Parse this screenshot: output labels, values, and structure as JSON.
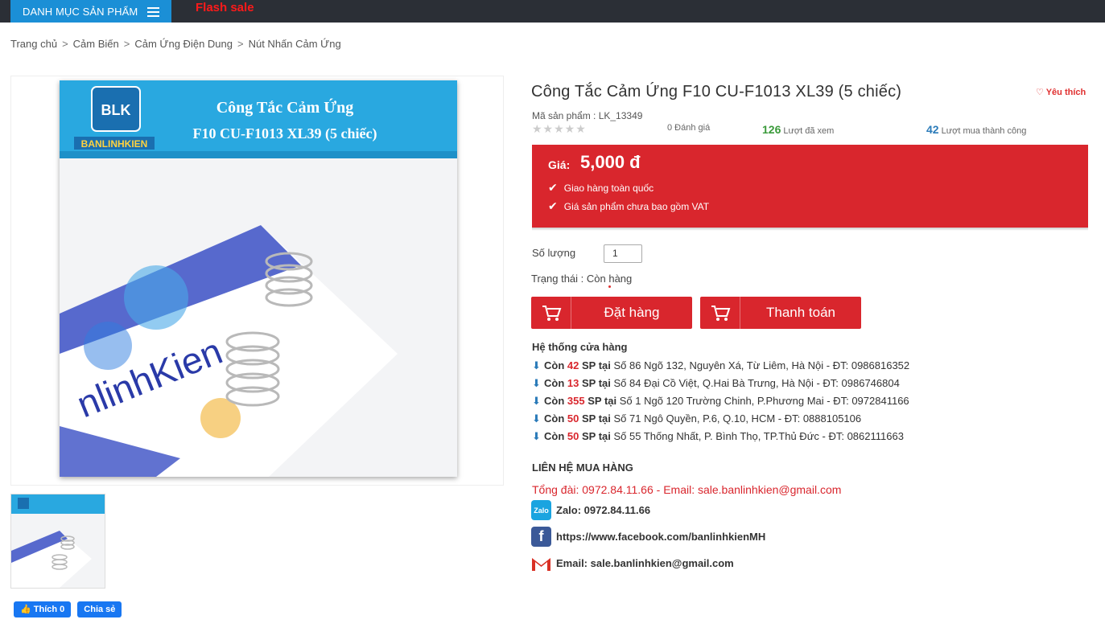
{
  "topbar": {
    "menu_label": "DANH MỤC SẢN PHẨM",
    "flash_label": "Flash sale"
  },
  "breadcrumb": [
    "Trang chủ",
    "Cảm Biến",
    "Cảm Ứng Điện Dung",
    "Nút Nhấn Cảm Ứng"
  ],
  "product": {
    "title": "Công Tắc Cảm Ứng F10 CU-F1013 XL39 (5 chiếc)",
    "image_title_line1": "Công Tắc Cảm Ứng",
    "image_title_line2": "F10 CU-F1013 XL39 (5 chiếc)",
    "logo_text": "BANLINHKIEN",
    "logo_mark": "BLK",
    "favorite_label": "Yêu thích",
    "sku_label": "Mã sản phẩm : LK_13349",
    "rating_label": "0 Đánh giá",
    "views_count": "126",
    "views_label": "Lượt đã xem",
    "purchases_count": "42",
    "purchases_label": "Lượt mua thành công",
    "price_label": "Giá:",
    "price_value": "5,000 đ",
    "features": [
      "Giao hàng toàn quốc",
      "Giá sản phẩm chưa bao gồm VAT"
    ],
    "quantity_label": "Số lượng",
    "quantity_value": "1",
    "status_label": "Trạng thái : Còn hàng",
    "order_button": "Đặt hàng",
    "checkout_button": "Thanh toán"
  },
  "stores": {
    "heading": "Hệ thống cửa hàng",
    "items": [
      {
        "pre": "Còn",
        "count": "42",
        "post": "SP tại",
        "address": "Số 86 Ngõ 132, Nguyên Xá, Từ Liêm, Hà Nội - ĐT: 0986816352"
      },
      {
        "pre": "Còn",
        "count": "13",
        "post": "SP tại",
        "address": "Số 84 Đại Cồ Việt, Q.Hai Bà Trưng, Hà Nội - ĐT: 0986746804"
      },
      {
        "pre": "Còn",
        "count": "355",
        "post": "SP tại",
        "address": "Số 1 Ngõ 120 Trường Chinh, P.Phương Mai - ĐT: 0972841166"
      },
      {
        "pre": "Còn",
        "count": "50",
        "post": "SP tại",
        "address": "Số 71 Ngô Quyền, P.6, Q.10, HCM - ĐT: 0888105106"
      },
      {
        "pre": "Còn",
        "count": "50",
        "post": "SP tại",
        "address": "Số 55 Thống Nhất, P. Bình Thọ, TP.Thủ Đức - ĐT: 0862111663"
      }
    ]
  },
  "contact": {
    "heading": "LIÊN HỆ MUA HÀNG",
    "hotline": "Tổng đài: 0972.84.11.66 - Email: sale.banlinhkien@gmail.com",
    "zalo_icon_text": "Zalo",
    "zalo": "Zalo: 0972.84.11.66",
    "facebook": "https://www.facebook.com/banlinhkienMH",
    "email": "Email: sale.banlinhkien@gmail.com"
  },
  "social": {
    "like_label": "Thích 0",
    "share_label": "Chia sẻ"
  },
  "colors": {
    "accent_red": "#d9262d",
    "menu_blue": "#1b8fd6",
    "topbar": "#2b2f36",
    "views_green": "#3a9a3a",
    "purchases_blue": "#2b7bb9"
  }
}
